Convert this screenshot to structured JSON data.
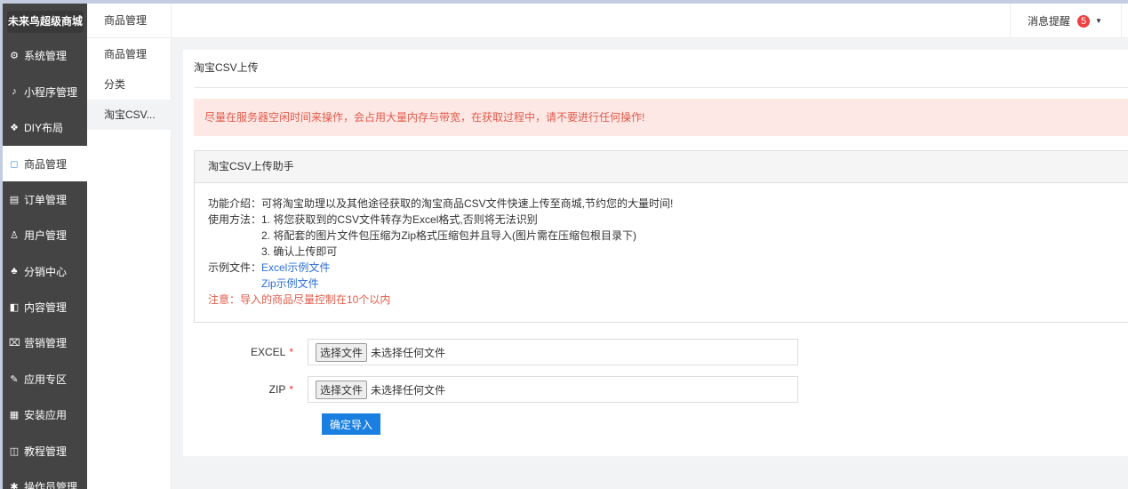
{
  "logo": "未来鸟超级商城",
  "menu": [
    {
      "label": "系统管理",
      "icon": "⚙"
    },
    {
      "label": "小程序管理",
      "icon": "♪"
    },
    {
      "label": "DIY布局",
      "icon": "❖"
    },
    {
      "label": "商品管理",
      "icon": "◻"
    },
    {
      "label": "订单管理",
      "icon": "▤"
    },
    {
      "label": "用户管理",
      "icon": "♙"
    },
    {
      "label": "分销中心",
      "icon": "♣"
    },
    {
      "label": "内容管理",
      "icon": "◧"
    },
    {
      "label": "营销管理",
      "icon": "⌧"
    },
    {
      "label": "应用专区",
      "icon": "✎"
    },
    {
      "label": "安装应用",
      "icon": "▦"
    },
    {
      "label": "教程管理",
      "icon": "◫"
    },
    {
      "label": "操作员管理",
      "icon": "✱"
    }
  ],
  "submenu": {
    "title": "商品管理",
    "items": [
      "商品管理",
      "分类",
      "淘宝CSV..."
    ]
  },
  "topbar": {
    "msg_label": "消息提醒",
    "msg_count": "5"
  },
  "page": {
    "title": "淘宝CSV上传",
    "alert": "尽量在服务器空闲时间来操作，会占用大量内存与带宽，在获取过程中，请不要进行任何操作!",
    "panel_title": "淘宝CSV上传助手",
    "intro_label": "功能介绍：",
    "intro": "可将淘宝助理以及其他途径获取的淘宝商品CSV文件快速上传至商城,节约您的大量时间!",
    "usage_label": "使用方法：",
    "steps": [
      "1. 将您获取到的CSV文件转存为Excel格式,否则将无法识别",
      "2. 将配套的图片文件包压缩为Zip格式压缩包并且导入(图片需在压缩包根目录下)",
      "3. 确认上传即可"
    ],
    "example_label": "示例文件：",
    "excel_link": "Excel示例文件",
    "zip_link": "Zip示例文件",
    "note": "注意：导入的商品尽量控制在10个以内"
  },
  "form": {
    "excel_label": "EXCEL",
    "zip_label": "ZIP",
    "required": "*",
    "choose": "选择文件",
    "no_file": "未选择任何文件",
    "submit": "确定导入"
  }
}
